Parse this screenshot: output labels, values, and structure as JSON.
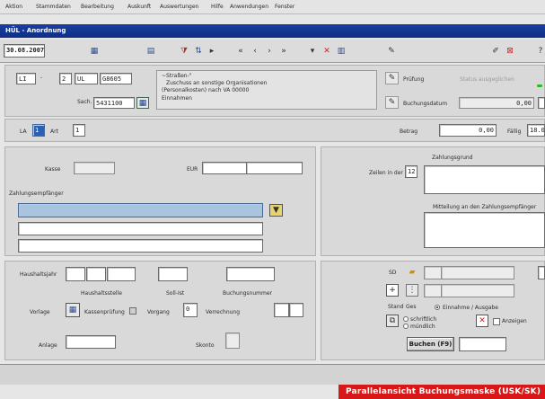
{
  "menubar": {
    "items": [
      "Aktion",
      "Stammdaten",
      "Bearbeitung",
      "Auskunft",
      "Auswertungen",
      "Hilfe",
      "Anwendungen",
      "Fenster"
    ]
  },
  "window": {
    "title": "HÜL - Anordnung"
  },
  "toolbar": {
    "date": "30.08.2007"
  },
  "header": {
    "field_a": "LI",
    "field_b": "2",
    "field_c": "UL",
    "field_d": "G8605",
    "field_e": "5431100",
    "description_line1": "~Straßen-\"",
    "description_line2": "Zuschuss an sonstige Organisationen",
    "description_line3": "(Personalkosten) nach VA 00000",
    "description_line4": "Einnahmen",
    "verification_label": "Prüfung",
    "accounting_label": "Buchungsdatum",
    "status_text": "Status ausgeglichen",
    "small_value": "0,00",
    "lbl_a": "Sach."
  },
  "row2": {
    "label_a": "LA",
    "value_a": "1",
    "label_b": "Art",
    "value_b": "1",
    "label_betrag": "Betrag",
    "betrag": "0,00",
    "label_faellig": "Fällig",
    "faellig": "18.0"
  },
  "left_panel": {
    "kasse_label": "Kasse",
    "betrag_label": "EUR",
    "recipient_section_label": "Zahlungsempfänger"
  },
  "right_panel": {
    "section_label": "Zahlungsgrund",
    "counter_label": "Zeilen in der",
    "counter_value": "12",
    "notes_label": "Mitteilung an den Zahlungsempfänger"
  },
  "bottom_left": {
    "label_haushalt": "Haushaltsjahr",
    "label_kapitel": "Haushaltsstelle",
    "label_sachkonto": "Soll-Ist",
    "label_buchungsnummer": "Buchungsnummer",
    "label_vorlage": "Vorlage",
    "label_kassenpruefung": "Kassenprüfung",
    "label_vorgang": "Vorgang",
    "vorgang_value": "0",
    "label_verrechnung": "Verrechnung",
    "label_anlage": "Anlage",
    "label_skonto": "Skonto"
  },
  "bottom_right": {
    "label_sd": "SD",
    "label_plus": "+",
    "label_stand": "Stand",
    "label_ges": "Ges",
    "radio_label": "Einnahme / Ausgabe",
    "small_label_1": "schriftlich",
    "small_label_2": "mündlich",
    "small_label_3": "Anzeigen",
    "buchen_button": "Buchen (F9)"
  },
  "caption": "Parallelansicht Buchungsmaske (USK/SK)"
}
